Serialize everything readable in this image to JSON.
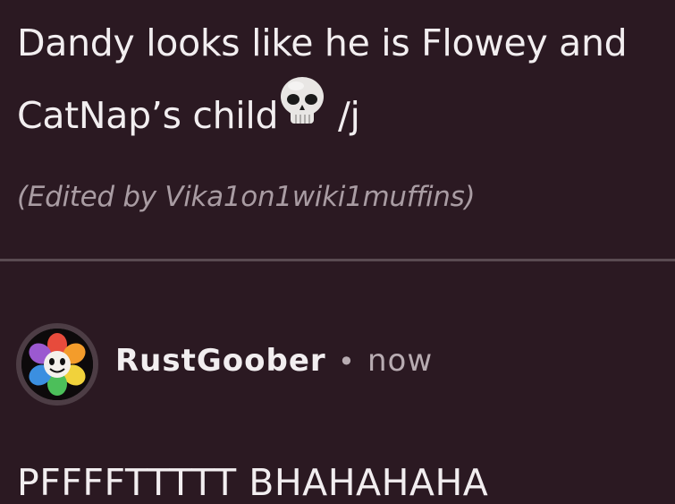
{
  "comment": {
    "line1": "Dandy looks like he is Flowey and",
    "line2_text": "CatNap’s child",
    "line2_emoji": "skull-emoji",
    "line2_suffix": " /j",
    "edited": "(Edited by Vika1on1wiki1muffins)"
  },
  "reply": {
    "author": "RustGoober",
    "separator": "•",
    "time": "now",
    "text": "PFFFFTTTTT BHAHAHAHA",
    "avatar": "flower-avatar-icon"
  },
  "colors": {
    "background": "#2b1922",
    "text": "#f2eef0",
    "muted": "#a99ca3",
    "divider": "#5a4b52"
  }
}
